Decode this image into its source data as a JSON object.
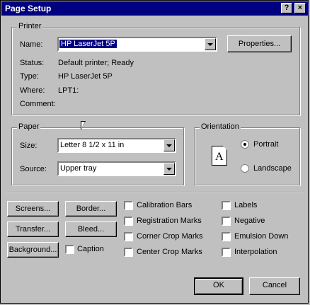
{
  "window": {
    "title": "Page Setup",
    "help_btn": "?",
    "close_btn": "×"
  },
  "printer": {
    "legend": "Printer",
    "name_label": "Name:",
    "name_value": "HP LaserJet 5P",
    "properties_button": "Properties...",
    "status_label": "Status:",
    "status_value": "Default printer; Ready",
    "type_label": "Type:",
    "type_value": "HP LaserJet 5P",
    "where_label": "Where:",
    "where_value": "LPT1:",
    "comment_label": "Comment:",
    "comment_value": ""
  },
  "paper": {
    "legend": "Paper",
    "size_label": "Size:",
    "size_value": "Letter 8 1/2 x 11 in",
    "source_label": "Source:",
    "source_value": "Upper tray"
  },
  "orientation": {
    "legend": "Orientation",
    "page_letter": "A",
    "portrait_label": "Portrait",
    "landscape_label": "Landscape",
    "selected": "Portrait"
  },
  "buttons": {
    "screens": "Screens...",
    "border": "Border...",
    "transfer": "Transfer...",
    "bleed": "Bleed...",
    "background": "Background...",
    "ok": "OK",
    "cancel": "Cancel"
  },
  "options": {
    "caption": "Caption",
    "calibration_bars": "Calibration Bars",
    "registration_marks": "Registration Marks",
    "corner_crop_marks": "Corner Crop Marks",
    "center_crop_marks": "Center Crop Marks",
    "labels": "Labels",
    "negative": "Negative",
    "emulsion_down": "Emulsion Down",
    "interpolation": "Interpolation"
  }
}
